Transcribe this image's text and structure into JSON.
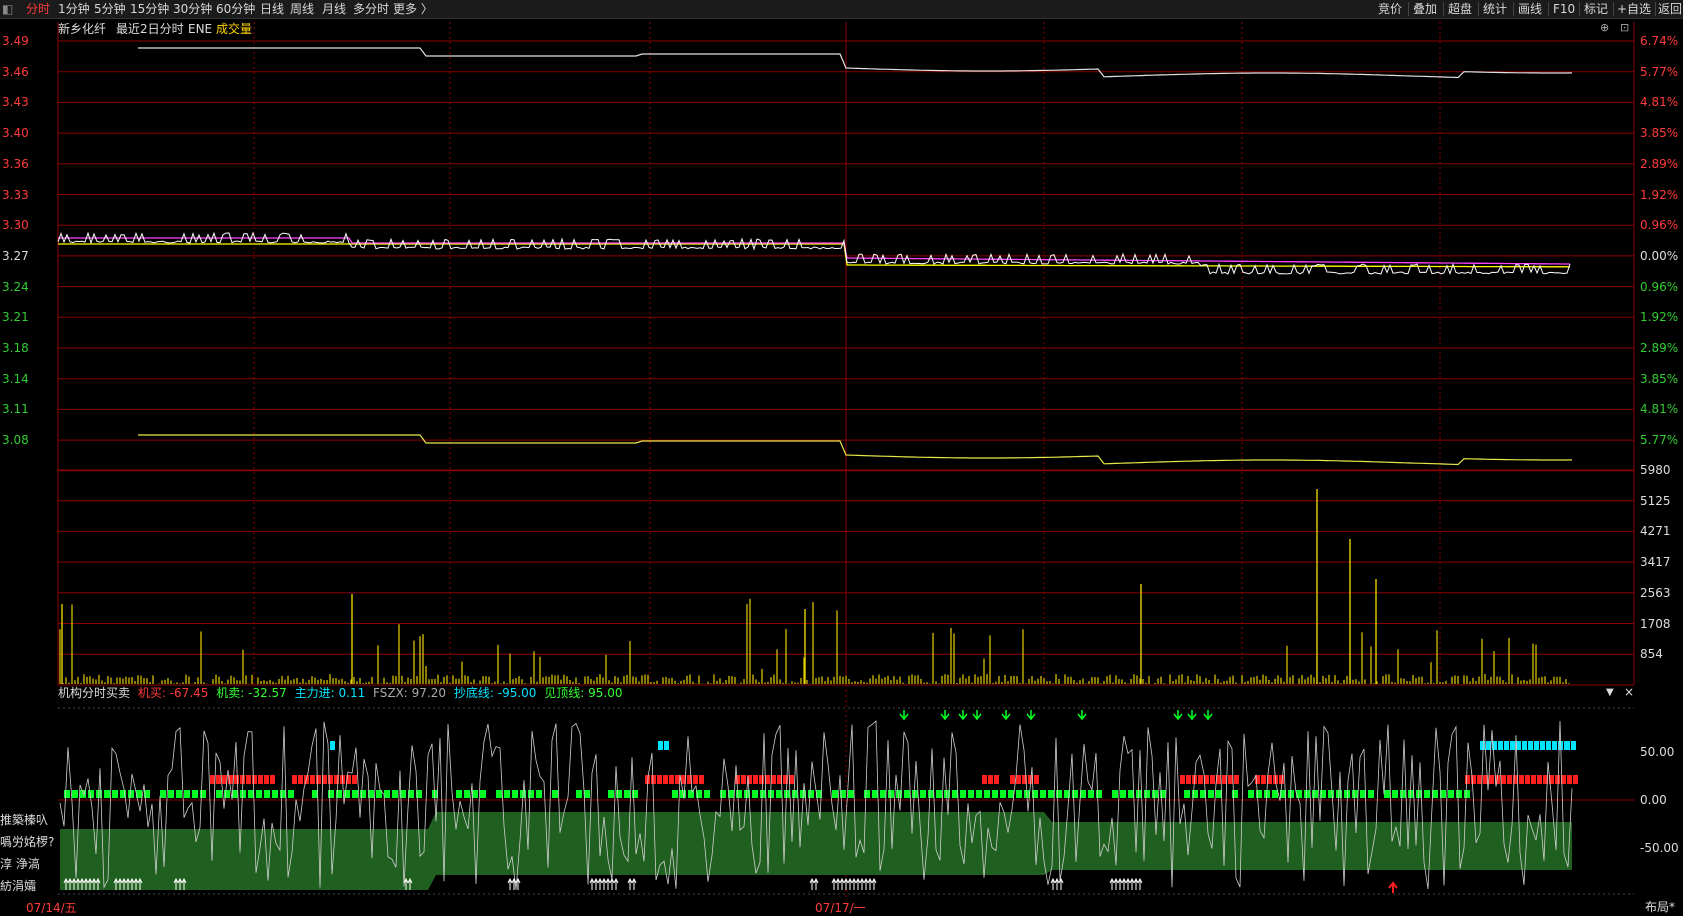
{
  "toolbar": {
    "left_tabs": [
      "分时",
      "1分钟",
      "5分钟",
      "15分钟",
      "30分钟",
      "60分钟",
      "日线",
      "周线",
      "月线",
      "多分时",
      "更多 〉"
    ],
    "right_tabs": [
      "竞价",
      "叠加",
      "超盘",
      "统计",
      "画线",
      "F10",
      "标记",
      "+自选",
      "返回"
    ]
  },
  "chart_header": {
    "stock_name": "新乡化纤",
    "period": "最近2日分时",
    "indicator": "ENE",
    "volume_label": "成交量"
  },
  "price_axis": {
    "left_labels": [
      "3.49",
      "3.46",
      "3.43",
      "3.40",
      "3.36",
      "3.33",
      "3.30",
      "3.27",
      "3.24",
      "3.21",
      "3.18",
      "3.14",
      "3.11",
      "3.08"
    ],
    "right_labels": [
      "6.74%",
      "5.77%",
      "4.81%",
      "3.85%",
      "2.89%",
      "1.92%",
      "0.96%",
      "0.00%",
      "0.96%",
      "1.92%",
      "2.89%",
      "3.85%",
      "4.81%",
      "5.77%"
    ]
  },
  "volume_axis": {
    "right_labels": [
      "5980",
      "5125",
      "4271",
      "3417",
      "2563",
      "1708",
      "854"
    ]
  },
  "indicator_panel": {
    "title": "机构分时买卖",
    "buy_label": "机买:",
    "buy_value": "-67.45",
    "sell_label": "机卖:",
    "sell_value": "-32.57",
    "main_label": "主力进:",
    "main_value": "0.11",
    "fszx_label": "FSZX:",
    "fszx_value": "97.20",
    "bottom_label": "抄底线:",
    "bottom_value": "-95.00",
    "top_label": "见顶线:",
    "top_value": "95.00",
    "right_labels": [
      "50.00",
      "0.00",
      "-50.00"
    ]
  },
  "side_menu": [
    "推築榛叺",
    "噅労姳椤?",
    "淳  浄滈",
    "紡涓孀"
  ],
  "dates": [
    "07/14/五",
    "07/17/一"
  ],
  "layout_button": "布局*",
  "colors": {
    "grid": "#8b0000",
    "price_line": "#ffffff",
    "avg_line": "#ffff00",
    "ma_line": "#ff44ff",
    "up_text": "#ff3b3b",
    "down_text": "#33cc33",
    "buy_bar": "#ff2020",
    "sell_bar": "#00ff22",
    "cyan": "#00e5ff",
    "band": "#1f5f1f"
  }
}
